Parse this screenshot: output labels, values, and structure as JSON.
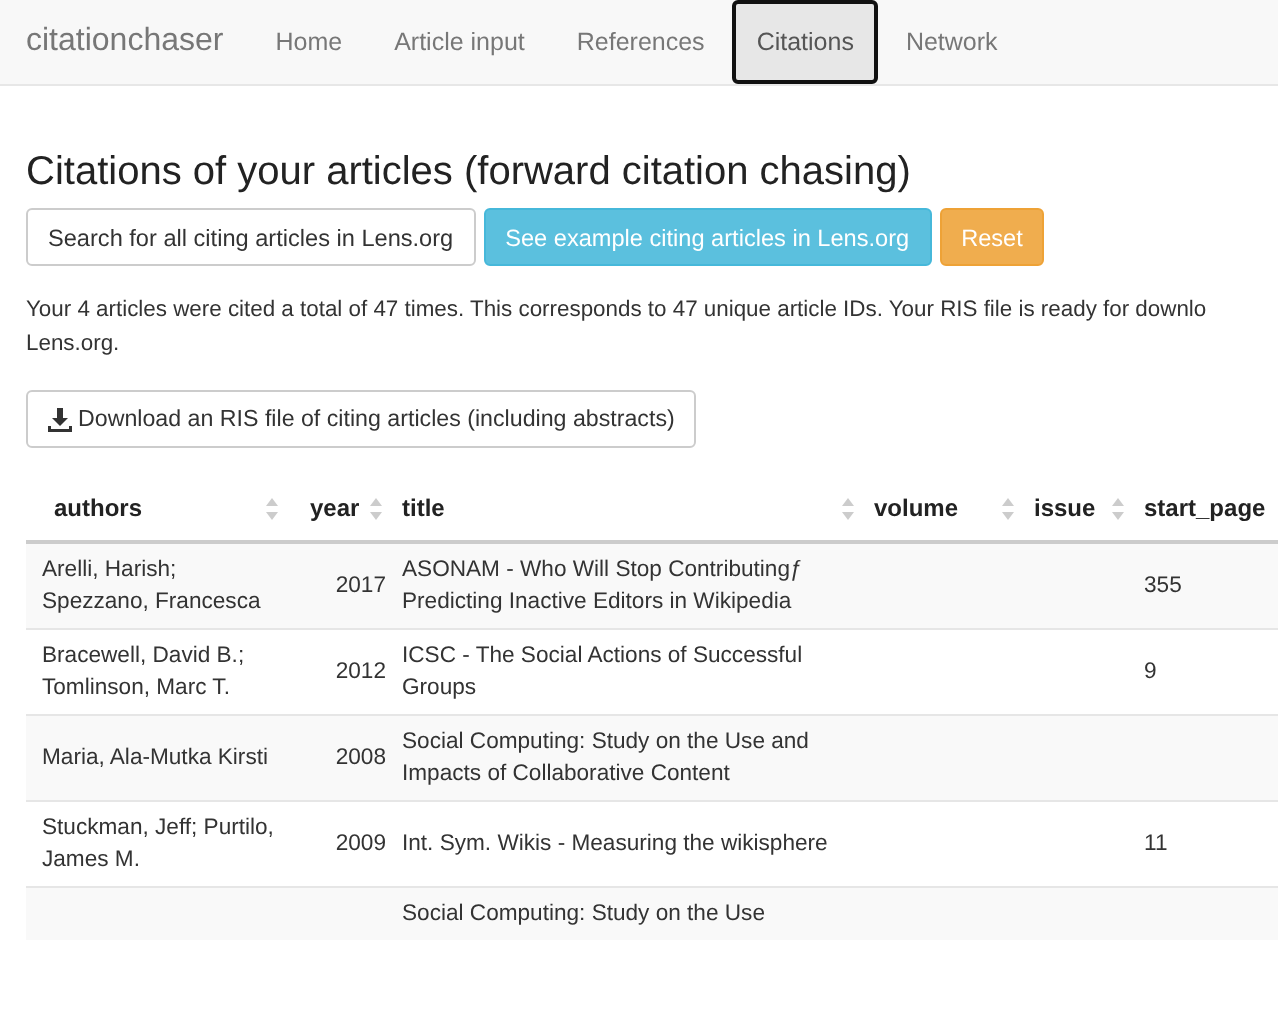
{
  "navbar": {
    "brand": "citationchaser",
    "tabs": [
      {
        "label": "Home",
        "selected": false
      },
      {
        "label": "Article input",
        "selected": false
      },
      {
        "label": "References",
        "selected": false
      },
      {
        "label": "Citations",
        "selected": true
      },
      {
        "label": "Network",
        "selected": false
      }
    ]
  },
  "heading": "Citations of your articles (forward citation chasing)",
  "buttons": [
    {
      "label": "Search for all citing articles in Lens.org",
      "kind": "default"
    },
    {
      "label": "See example citing articles in Lens.org",
      "kind": "info"
    },
    {
      "label": "Reset",
      "kind": "warning"
    }
  ],
  "summary_lines": [
    "Your 4 articles were cited a total of 47 times. This corresponds to 47 unique article IDs. Your RIS file is ready for downlo",
    "Lens.org."
  ],
  "download_button": {
    "label": "Download an RIS file of citing articles (including abstracts)"
  },
  "table": {
    "columns": [
      {
        "label": "authors"
      },
      {
        "label": "year"
      },
      {
        "label": "title"
      },
      {
        "label": "volume"
      },
      {
        "label": "issue"
      },
      {
        "label": "start_page"
      }
    ],
    "rows": [
      {
        "authors": "Arelli, Harish; Spezzano, Francesca",
        "year": "2017",
        "title": "ASONAM - Who Will Stop Contributingƒ Predicting Inactive Editors in Wikipedia",
        "start_page": "355"
      },
      {
        "authors": "Bracewell, David B.; Tomlinson, Marc T.",
        "year": "2012",
        "title": "ICSC - The Social Actions of Successful Groups",
        "start_page": "9"
      },
      {
        "authors": "Maria, Ala-Mutka Kirsti",
        "year": "2008",
        "title": "Social Computing: Study on the Use and Impacts of Collaborative Content"
      },
      {
        "authors": "Stuckman, Jeff; Purtilo, James M.",
        "year": "2009",
        "title": "Int. Sym. Wikis - Measuring the wikisphere",
        "start_page": "11"
      },
      {
        "title": "Social Computing: Study on the Use"
      }
    ]
  }
}
